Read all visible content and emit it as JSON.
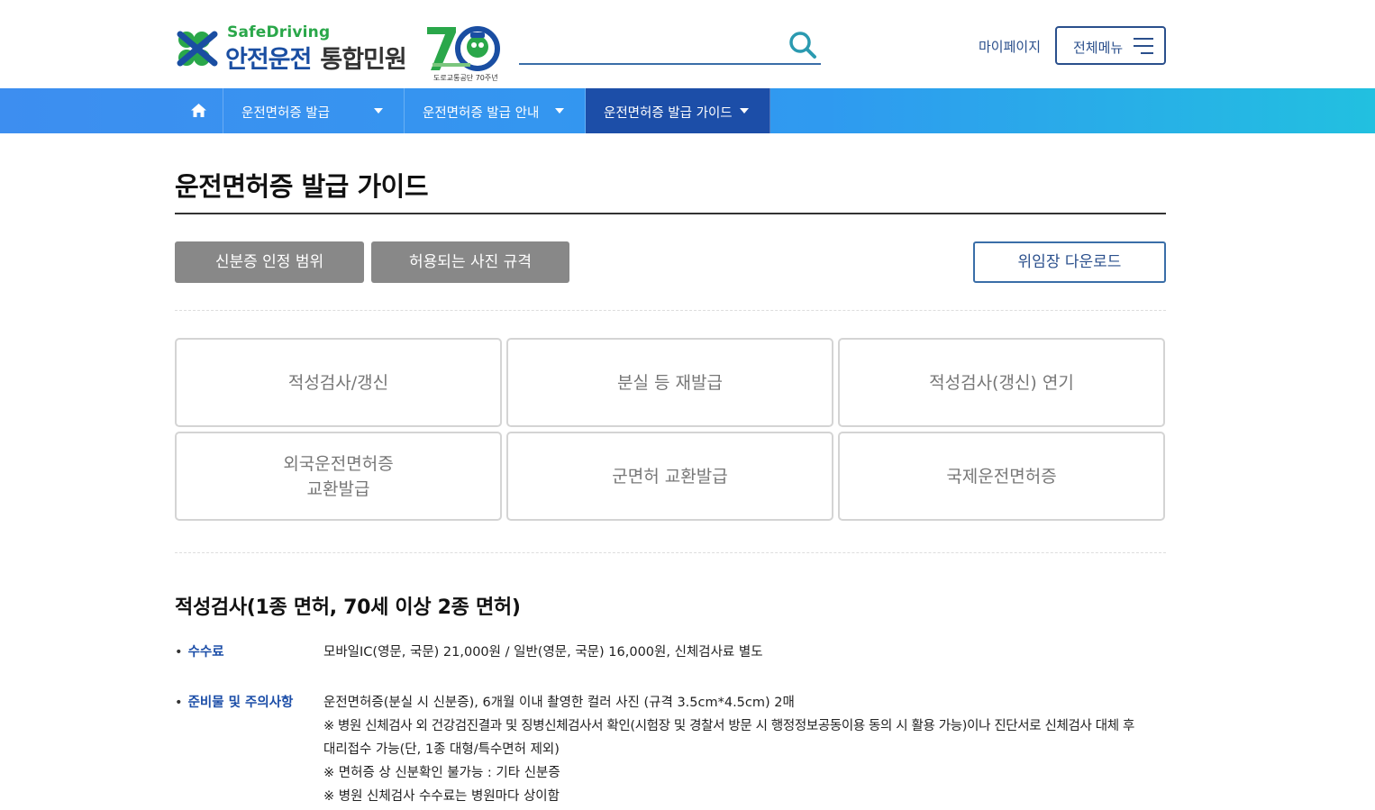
{
  "header": {
    "brand_en": "SafeDriving",
    "brand_ko": "안전운전",
    "brand_sub": "통합민원",
    "anniv_caption": "도로교통공단 70주년",
    "search_placeholder": "",
    "mypage_label": "마이페이지",
    "allmenu_label": "전체메뉴"
  },
  "nav": {
    "items": [
      {
        "label": "운전면허증 발급"
      },
      {
        "label": "운전면허증 발급 안내"
      },
      {
        "label": "운전면허증 발급 가이드"
      }
    ]
  },
  "page": {
    "title": "운전면허증 발급 가이드",
    "buttons": {
      "id_scope": "신분증 인정 범위",
      "photo_spec": "허용되는 사진 규격",
      "proxy_download": "위임장 다운로드"
    },
    "categories": [
      {
        "line1": "적성검사/갱신",
        "line2": ""
      },
      {
        "line1": "분실 등 재발급",
        "line2": ""
      },
      {
        "line1": "적성검사(갱신) 연기",
        "line2": ""
      },
      {
        "line1": "외국운전면허증",
        "line2": "교환발급"
      },
      {
        "line1": "군면허 교환발급",
        "line2": ""
      },
      {
        "line1": "국제운전면허증",
        "line2": ""
      }
    ],
    "section": {
      "title": "적성검사(1종 면허, 70세 이상 2종 면허)",
      "fee_label": "수수료",
      "fee_text": "모바일IC(영문, 국문) 21,000원 / 일반(영문, 국문) 16,000원, 신체검사료 별도",
      "prep_label": "준비물 및 주의사항",
      "prep_lines": [
        "운전면허증(분실 시 신분증), 6개월 이내 촬영한 컬러 사진 (규격 3.5cm*4.5cm) 2매",
        "※ 병원 신체검사 외 건강검진결과 및 징병신체검사서 확인(시험장 및 경찰서 방문 시 행정정보공동이용 동의 시 활용 가능)이나 진단서로 신체검사 대체 후",
        "대리접수 가능(단, 1종 대형/특수면허 제외)",
        "※ 면허증 상 신분확인 불가능 : 기타 신분증",
        "※ 병원 신체검사 수수료는 병원마다 상이함"
      ]
    }
  },
  "colors": {
    "brand_blue": "#1a4ea2",
    "brand_green": "#2aa74a",
    "nav_active": "#1c4ea8",
    "gray_button": "#888888"
  }
}
